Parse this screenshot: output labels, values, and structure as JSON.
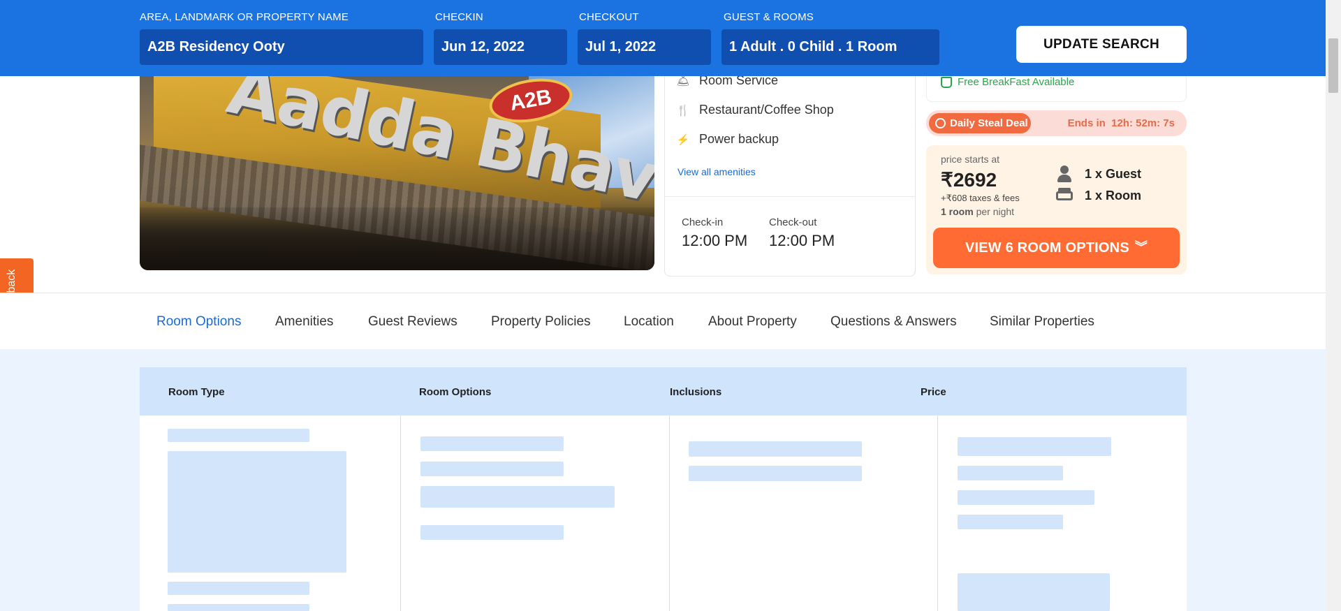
{
  "search": {
    "property_label": "AREA, LANDMARK OR PROPERTY NAME",
    "property_value": "A2B Residency Ooty",
    "checkin_label": "CHECKIN",
    "checkin_value": "Jun 12, 2022",
    "checkout_label": "CHECKOUT",
    "checkout_value": "Jul 1, 2022",
    "guests_label": "GUEST & ROOMS",
    "guests_value": "1 Adult . 0 Child . 1 Room",
    "update_label": "UPDATE SEARCH"
  },
  "amenities": {
    "items": [
      "Room Service",
      "Restaurant/Coffee Shop",
      "Power backup"
    ],
    "icons": [
      "room-service-icon",
      "cutlery-icon",
      "power-icon"
    ],
    "view_all": "View all amenities",
    "checkin_label": "Check-in",
    "checkin_time": "12:00 PM",
    "checkout_label": "Check-out",
    "checkout_time": "12:00 PM"
  },
  "offer": {
    "breakfast": "Free BreakFast Available",
    "deal_label": "Daily Steal Deal",
    "deal_ends": "Ends in  12h: 52m: 7s"
  },
  "pricing": {
    "starts_at": "price starts at",
    "price": "₹2692",
    "taxes": "+₹608 taxes & fees",
    "night_bold": "1 room",
    "night_rest": " per night",
    "guests": "1 x Guest",
    "rooms": "1 x Room",
    "cta": "VIEW 6 ROOM OPTIONS"
  },
  "photo": {
    "sign_text": "Aadda Bhavan",
    "badge_text": "A2B"
  },
  "feedback": {
    "label": "Feedback"
  },
  "tabs": [
    "Room Options",
    "Amenities",
    "Guest Reviews",
    "Property Policies",
    "Location",
    "About Property",
    "Questions & Answers",
    "Similar Properties"
  ],
  "table": {
    "headers": [
      "Room Type",
      "Room Options",
      "Inclusions",
      "Price"
    ]
  },
  "colors": {
    "brand_blue": "#1a73e0",
    "cta_orange": "#ff6b33",
    "deal_orange": "#f26a3f",
    "success_green": "#2ba54c"
  }
}
